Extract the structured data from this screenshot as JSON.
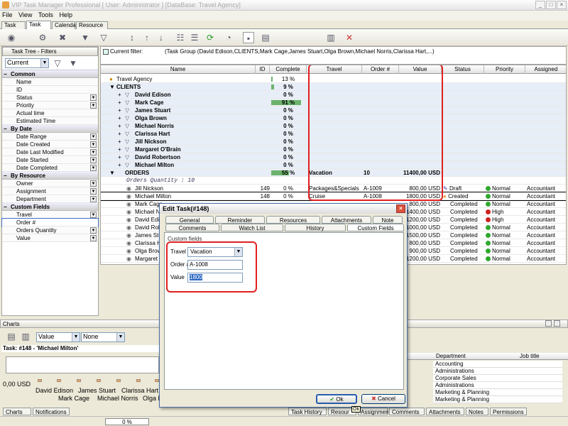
{
  "window": {
    "title": "VIP Task Manager Professional [ User: Administrator ] [DataBase: Travel Agency]"
  },
  "menu": [
    "File",
    "View",
    "Tools",
    "Help"
  ],
  "tabs": [
    "Task List",
    "Task Tree",
    "Calendar",
    "Resource List"
  ],
  "filters_panel": {
    "title": "Task Tree - Filters",
    "current": "Current",
    "sections": [
      {
        "name": "Common",
        "items": [
          "Name",
          "ID",
          "Status",
          "Priority",
          "Actual time",
          "Estimated Time"
        ]
      },
      {
        "name": "By Date",
        "items": [
          "Date Range",
          "Date Created",
          "Date Last Modified",
          "Date Started",
          "Date Completed"
        ]
      },
      {
        "name": "By Resource",
        "items": [
          "Owner",
          "Assignment",
          "Department"
        ]
      },
      {
        "name": "Custom Fields",
        "items": [
          "Travel",
          "Order #",
          "Orders Quantity",
          "Value"
        ]
      }
    ]
  },
  "filter": {
    "label": "Current filter:",
    "text": "(Task Group  (David Edison,CLIENTS,Mark Cage,James Stuart,Olga Brown,Michael Norris,Clarissa Hart,...)"
  },
  "grid": {
    "columns": [
      "Name",
      "ID",
      "Complete",
      "Travel",
      "Order #",
      "Value",
      "Status",
      "Priority",
      "Assigned"
    ],
    "root": "Travel Agency",
    "root_complete": "13 %",
    "clients": {
      "name": "CLIENTS",
      "complete": "9 %",
      "pct": 9
    },
    "client_rows": [
      {
        "name": "David Edison",
        "complete": "0 %"
      },
      {
        "name": "Mark Cage",
        "complete": "91 %",
        "pct": 91
      },
      {
        "name": "James Stuart",
        "complete": "0 %"
      },
      {
        "name": "Olga Brown",
        "complete": "0 %"
      },
      {
        "name": "Michael Norris",
        "complete": "0 %"
      },
      {
        "name": "Clarissa Hart",
        "complete": "0 %"
      },
      {
        "name": "Jill Nickson",
        "complete": "0 %"
      },
      {
        "name": "Margaret O'Brain",
        "complete": "0 %"
      },
      {
        "name": "David Robertson",
        "complete": "0 %"
      },
      {
        "name": "Michael Milton",
        "complete": "0 %"
      }
    ],
    "orders": {
      "name": "ORDERS",
      "complete": "55 %",
      "pct": 55,
      "travel": "Vacation",
      "order": "10",
      "value": "11400,00 USD"
    },
    "orders_qty": "Orders Quantity : 10",
    "order_rows": [
      {
        "name": "Jill Nickson",
        "id": "149",
        "complete": "0 %",
        "travel": "Packages&Specials",
        "order": "A-1009",
        "value": "800,00 USD",
        "status": "Draft",
        "priority": "Normal",
        "assigned": "Accountant"
      },
      {
        "name": "Michael Milton",
        "id": "148",
        "complete": "0 %",
        "travel": "Cruise",
        "order": "A-1008",
        "value": "1800,00 USD",
        "status": "Created",
        "priority": "Normal",
        "assigned": "Accountant"
      },
      {
        "name": "Mark Cage",
        "value": "800,00 USD",
        "status": "Completed",
        "priority": "Normal",
        "assigned": "Accountant"
      },
      {
        "name": "Michael Nor",
        "value": "1400,00 USD",
        "status": "Completed",
        "priority": "High",
        "assigned": "Accountant"
      },
      {
        "name": "David Ediso",
        "value": "1200,00 USD",
        "status": "Completed",
        "priority": "High",
        "assigned": "Accountant"
      },
      {
        "name": "David Robe",
        "value": "1000,00 USD",
        "status": "Completed",
        "priority": "Normal",
        "assigned": "Accountant"
      },
      {
        "name": "James Stua",
        "value": "1500,00 USD",
        "status": "Completed",
        "priority": "Normal",
        "assigned": "Accountant"
      },
      {
        "name": "Clarissa Ha",
        "value": "800,00 USD",
        "status": "Completed",
        "priority": "Normal",
        "assigned": "Accountant"
      },
      {
        "name": "Olga Brown",
        "value": "900,00 USD",
        "status": "Completed",
        "priority": "Normal",
        "assigned": "Accountant"
      },
      {
        "name": "Margaret O",
        "value": "1200,00 USD",
        "status": "Completed",
        "priority": "Normal",
        "assigned": "Accountant"
      }
    ]
  },
  "dialog": {
    "title": "Edit Task(#148)",
    "tabs_row1": [
      "General",
      "Reminder",
      "Resources",
      "Attachments",
      "Note"
    ],
    "tabs_row2": [
      "Comments",
      "Watch List",
      "History",
      "Custom Fields"
    ],
    "group": "Custom fields",
    "travel_label": "Travel",
    "travel_value": "Vacation",
    "order_label": "Order #",
    "order_value": "A-1008",
    "value_label": "Value",
    "value_value": "1800",
    "ok": "Ok",
    "cancel": "Cancel",
    "tooltip": "Ok"
  },
  "charts": {
    "title": "Charts",
    "combo1": "Value",
    "combo2": "None",
    "task": "Task: #148 - 'Michael Milton'",
    "axis_value": "0,00 USD",
    "labels_row1": [
      "David Edison",
      "James Stuart",
      "Clarissa Hart"
    ],
    "labels_row2": [
      "Mark Cage",
      "Michael Norris",
      "Olga Br"
    ]
  },
  "resource": {
    "col1": "Department",
    "col2": "Job title",
    "rows": [
      "Accounting",
      "Administrations",
      "Corporate Sales",
      "Administrations",
      "Marketing & Planning",
      "Marketing & Planning"
    ]
  },
  "bottom_tabs_left": [
    "Charts",
    "Notifications"
  ],
  "bottom_tabs_right": [
    "Task History",
    "Resour",
    "Assignment",
    "Comments",
    "Attachments",
    "Notes",
    "Permissions"
  ],
  "status": {
    "progress": "0 %"
  },
  "colors": {
    "highlight": "#e02020",
    "green": "#2fa82f",
    "red": "#d02020"
  }
}
